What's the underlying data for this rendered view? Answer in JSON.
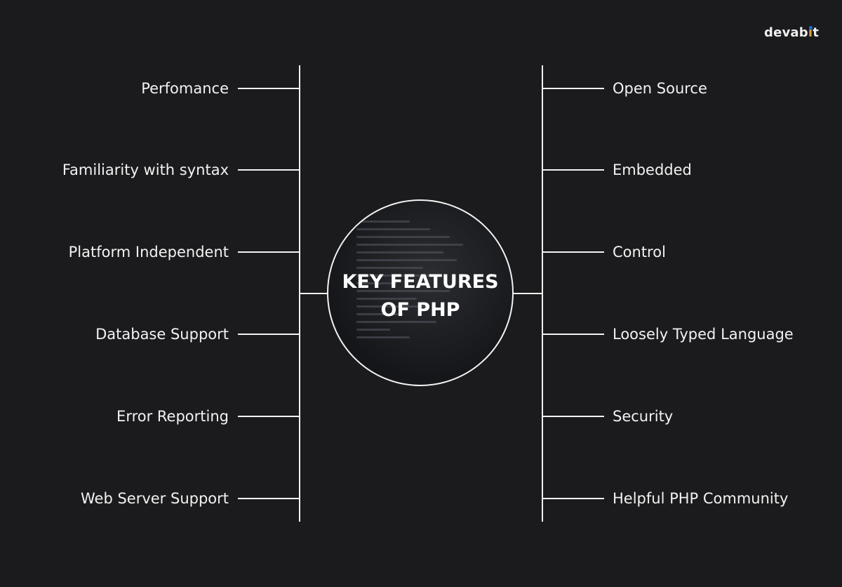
{
  "logo": {
    "text_main": "devab",
    "text_i": "i",
    "text_end": "t"
  },
  "center": {
    "line1": "KEY FEATURES",
    "line2": "OF PHP"
  },
  "left_features": [
    "Perfomance",
    "Familiarity with syntax",
    "Platform Independent",
    "Database Support",
    "Error Reporting",
    "Web Server Support"
  ],
  "right_features": [
    "Open Source",
    "Embedded",
    "Control",
    "Loosely Typed Language",
    "Security",
    "Helpful PHP Community"
  ],
  "colors": {
    "background": "#1b1b1d",
    "line": "#f2f2f2",
    "logo_dot": "#1f6fd6",
    "logo_accent": "#d9a24a"
  }
}
